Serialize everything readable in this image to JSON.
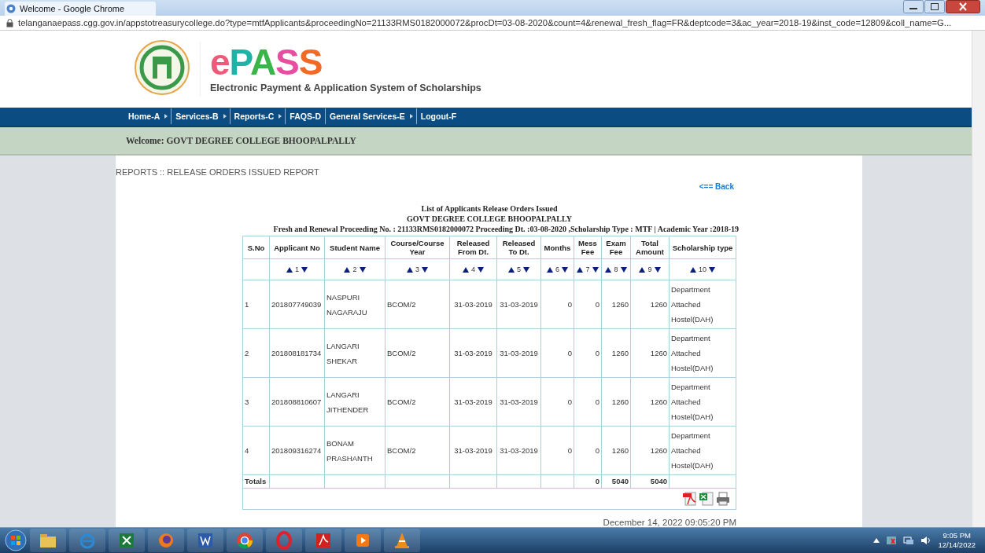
{
  "window": {
    "title": "Welcome - Google Chrome",
    "url": "telanganaepass.cgg.gov.in/appstotreasurycollege.do?type=mtfApplicants&proceedingNo=21133RMS0182000072&procDt=03-08-2020&count=4&renewal_fresh_flag=FR&deptcode=3&ac_year=2018-19&inst_code=12809&coll_name=G..."
  },
  "header": {
    "logo_letters": [
      {
        "text": "e",
        "color": "#ee5a7a"
      },
      {
        "text": "P",
        "color": "#1fb3a8"
      },
      {
        "text": "A",
        "color": "#3bb54a"
      },
      {
        "text": "S",
        "color": "#e84ea0"
      },
      {
        "text": "S",
        "color": "#f26a24"
      }
    ],
    "tagline": "Electronic Payment & Application System of Scholarships"
  },
  "nav": [
    {
      "label": "Home-A",
      "has_submenu": true
    },
    {
      "label": "Services-B",
      "has_submenu": true
    },
    {
      "label": "Reports-C",
      "has_submenu": true
    },
    {
      "label": "FAQS-D",
      "has_submenu": false
    },
    {
      "label": "General Services-E",
      "has_submenu": true
    },
    {
      "label": "Logout-F",
      "has_submenu": false
    }
  ],
  "welcome": "Welcome: GOVT DEGREE COLLEGE BHOOPALPALLY",
  "breadcrumb": "REPORTS :: RELEASE ORDERS ISSUED REPORT",
  "back_link": "<== Back",
  "report_titles": [
    "List of Applicants Release Orders Issued",
    "GOVT DEGREE COLLEGE BHOOPALPALLY",
    "Fresh and Renewal Proceeding No. : 21133RMS0182000072 Proceeding Dt. :03-08-2020 ,Scholarship Type : MTF | Academic Year :2018-19"
  ],
  "table": {
    "columns": [
      {
        "label": "S.No"
      },
      {
        "label": "Applicant No",
        "sort": "1"
      },
      {
        "label": "Student Name",
        "sort": "2"
      },
      {
        "label": "Course/Course Year",
        "sort": "3"
      },
      {
        "label": "Released From Dt.",
        "sort": "4"
      },
      {
        "label": "Released To Dt.",
        "sort": "5"
      },
      {
        "label": "Months",
        "sort": "6"
      },
      {
        "label": "Mess Fee",
        "sort": "7"
      },
      {
        "label": "Exam Fee",
        "sort": "8"
      },
      {
        "label": "Total Amount",
        "sort": "9"
      },
      {
        "label": "Scholarship type",
        "sort": "10"
      }
    ],
    "rows": [
      [
        "1",
        "201807749039",
        "NASPURI NAGARAJU",
        "BCOM/2",
        "31-03-2019",
        "31-03-2019",
        "0",
        "0",
        "1260",
        "1260",
        "Department Attached Hostel(DAH)"
      ],
      [
        "2",
        "201808181734",
        "LANGARI SHEKAR",
        "BCOM/2",
        "31-03-2019",
        "31-03-2019",
        "0",
        "0",
        "1260",
        "1260",
        "Department Attached Hostel(DAH)"
      ],
      [
        "3",
        "201808810607",
        "LANGARI JITHENDER",
        "BCOM/2",
        "31-03-2019",
        "31-03-2019",
        "0",
        "0",
        "1260",
        "1260",
        "Department Attached Hostel(DAH)"
      ],
      [
        "4",
        "201809316274",
        "BONAM PRASHANTH",
        "BCOM/2",
        "31-03-2019",
        "31-03-2019",
        "0",
        "0",
        "1260",
        "1260",
        "Department Attached Hostel(DAH)"
      ]
    ],
    "totals": {
      "label": "Totals",
      "mess_fee": "0",
      "exam_fee": "5040",
      "total_amount": "5040"
    }
  },
  "export_icons": [
    {
      "kind": "pdf"
    },
    {
      "kind": "excel"
    },
    {
      "kind": "print"
    }
  ],
  "generated_at": "December 14, 2022 09:05:20 PM",
  "taskbar": {
    "apps": [
      {
        "kind": "folder"
      },
      {
        "kind": "ie"
      },
      {
        "kind": "excel"
      },
      {
        "kind": "firefox"
      },
      {
        "kind": "word"
      },
      {
        "kind": "chrome"
      },
      {
        "kind": "opera"
      },
      {
        "kind": "pdf"
      },
      {
        "kind": "media"
      },
      {
        "kind": "cone"
      }
    ],
    "time": "9:05 PM",
    "date": "12/14/2022"
  }
}
